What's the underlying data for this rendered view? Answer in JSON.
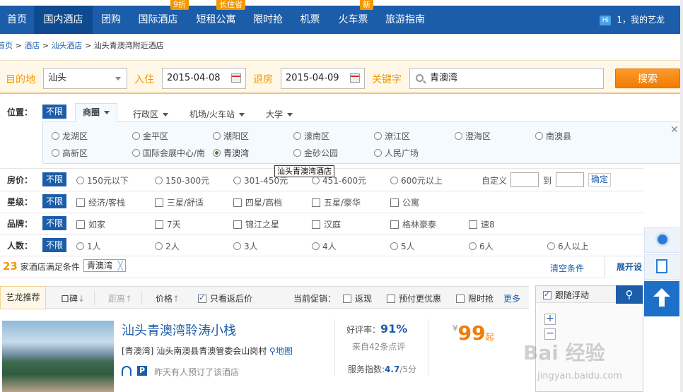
{
  "nav": {
    "items": [
      "首页",
      "国内酒店",
      "团购",
      "国际酒店",
      "短租公寓",
      "限时抢",
      "机票",
      "火车票",
      "旅游指南"
    ],
    "active_index": 1,
    "badges": {
      "intl": "9折",
      "rental": "长住省",
      "train": "新"
    },
    "user_icon": "Hi",
    "user_text": "1，我的艺龙"
  },
  "breadcrumb": {
    "home": "首页",
    "hotel": "酒店",
    "city": "汕头酒店",
    "current": "汕头青澳湾附近酒店",
    "sep": ">"
  },
  "search": {
    "dest_label": "目的地",
    "dest_value": "汕头",
    "checkin_label": "入住",
    "checkin_value": "2015-04-08",
    "checkout_label": "退房",
    "checkout_value": "2015-04-09",
    "keyword_label": "关键字",
    "keyword_value": "青澳湾",
    "button": "搜索"
  },
  "filters": {
    "unlimited": "不限",
    "location_label": "位置：",
    "location_tabs": [
      "商圈",
      "行政区",
      "机场/火车站",
      "大学"
    ],
    "districts_row1": [
      "龙湖区",
      "金平区",
      "潮阳区",
      "濠南区",
      "潦江区",
      "澄海区",
      "南澳县"
    ],
    "districts_row2": [
      "高新区",
      "国际会展中心/南",
      "青澳湾",
      "金砂公园",
      "人民广场"
    ],
    "district_selected": "青澳湾",
    "tooltip": "汕头青澳湾酒店",
    "price_label": "房价：",
    "prices": [
      "150元以下",
      "150-300元",
      "301-450元",
      "451-600元",
      "600元以上"
    ],
    "custom_label": "自定义",
    "to_label": "到",
    "confirm": "确定",
    "star_label": "星级：",
    "stars": [
      "经济/客栈",
      "三星/舒适",
      "四星/高档",
      "五星/豪华",
      "公寓"
    ],
    "brand_label": "品牌：",
    "brands": [
      "如家",
      "7天",
      "锦江之星",
      "汉庭",
      "格林豪泰",
      "速8"
    ],
    "people_label": "人数：",
    "people": [
      "1人",
      "2人",
      "3人",
      "4人",
      "5人",
      "6人",
      "6人以上"
    ]
  },
  "results": {
    "count": "23",
    "count_text": "家酒店满足条件",
    "tag": "青澳湾",
    "tag_close": "╳",
    "clear": "清空条件",
    "expand": "展开设"
  },
  "sort": {
    "recommend": "艺龙推荐",
    "reputation": "口碑",
    "distance": "距离",
    "price": "价格",
    "rebate_only": "只看返后价",
    "promo_label": "当前促销：",
    "promos": [
      "返现",
      "预付更优惠",
      "限时抢"
    ],
    "more": "更多"
  },
  "hotel": {
    "name": "汕头青澳湾聆涛小栈",
    "area": "[青澳湾]",
    "address": "汕头南澳县青澳管委会山岗村",
    "map_link": "地图",
    "booked": "昨天有人预订了该酒店",
    "rating_label": "好评率：",
    "rating": "91%",
    "reviews": "来自42条点评",
    "service_label": "服务指数:",
    "service_value": "4.7",
    "service_max": "/5分",
    "currency": "¥",
    "price": "99",
    "price_suffix": "起"
  },
  "map": {
    "follow": "跟随浮动",
    "zoom_in": "+",
    "zoom_out": "−"
  },
  "watermark": {
    "brand": "Bai 经验",
    "url": "jingyan.baidu.com"
  }
}
